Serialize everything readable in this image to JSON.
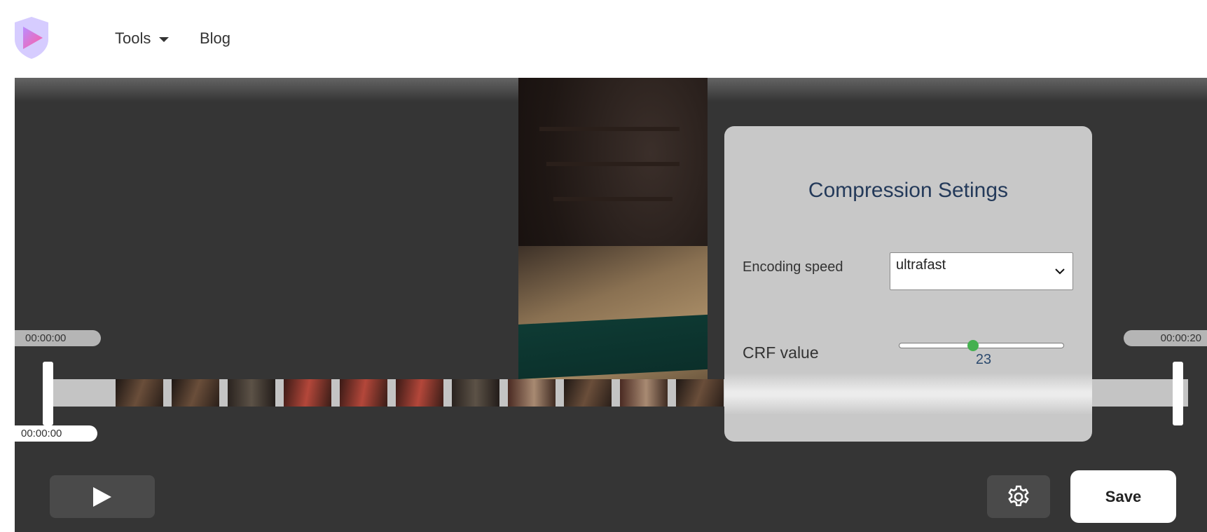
{
  "nav": {
    "tools_label": "Tools",
    "blog_label": "Blog"
  },
  "timeline": {
    "start_time": "00:00:00",
    "end_time": "00:00:20",
    "current_time": "00:00:00",
    "thumbnail_count": 11
  },
  "controls": {
    "save_label": "Save"
  },
  "settings_panel": {
    "title": "Compression Setings",
    "encoding_label": "Encoding speed",
    "encoding_value": "ultrafast",
    "crf_label": "CRF value",
    "crf_value": "23",
    "crf_min": 0,
    "crf_max": 51
  },
  "colors": {
    "editor_bg": "#353535",
    "panel_bg": "#c8c8c8",
    "accent_green": "#45b04f",
    "title_color": "#243a5a"
  }
}
